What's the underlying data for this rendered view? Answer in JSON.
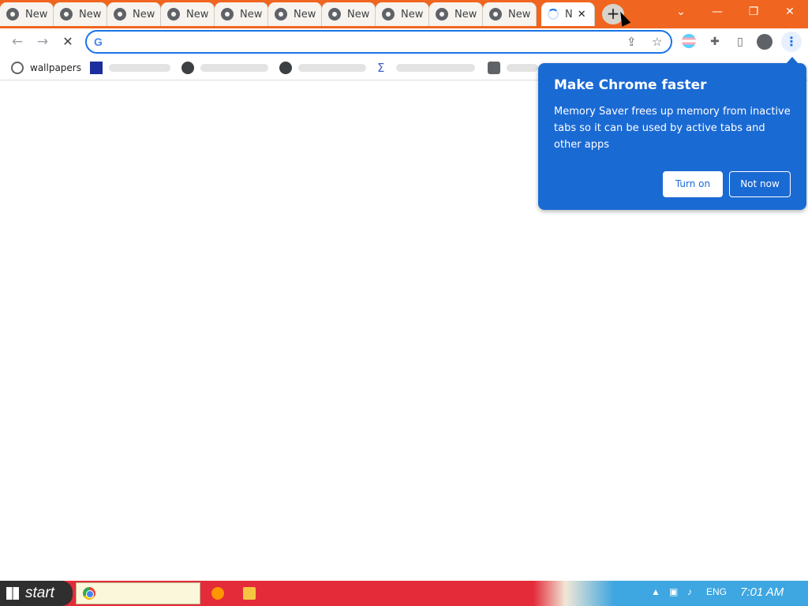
{
  "browser": {
    "tabs": [
      {
        "label": "New",
        "state": "loaded"
      },
      {
        "label": "New",
        "state": "loaded"
      },
      {
        "label": "New",
        "state": "loaded"
      },
      {
        "label": "New",
        "state": "loaded"
      },
      {
        "label": "New",
        "state": "loaded"
      },
      {
        "label": "New",
        "state": "loaded"
      },
      {
        "label": "New",
        "state": "loaded"
      },
      {
        "label": "New",
        "state": "loaded"
      },
      {
        "label": "New",
        "state": "loaded"
      },
      {
        "label": "New",
        "state": "loaded"
      },
      {
        "label": "N",
        "state": "loading",
        "active": true
      }
    ],
    "new_tab_icon": "plus-icon",
    "window_controls": [
      "chevron-down-icon",
      "minimize-icon",
      "restore-icon",
      "close-icon"
    ],
    "toolbar": {
      "back_icon": "arrow-left-icon",
      "forward_icon": "arrow-right-icon",
      "stop_icon": "stop-loading-icon",
      "omnibox_value": "",
      "omnibox_icon": "google-g-icon",
      "share_icon": "share-icon",
      "bookmark_star_icon": "star-icon",
      "extensions_icon": "puzzle-icon",
      "side_panel_icon": "side-panel-icon",
      "profile_icon": "person-icon",
      "menu_icon": "kebab-menu-icon"
    },
    "bookmarks": [
      {
        "label": "wallpapers",
        "icon": "globe-icon"
      },
      {
        "label": "[placeholder]",
        "icon": "generic-site-icon"
      },
      {
        "label": "[placeholder]",
        "icon": "globe-icon"
      },
      {
        "label": "[placeholder]",
        "icon": "globe-icon"
      },
      {
        "label": "[placeholder]",
        "icon": "sigma-icon"
      },
      {
        "label": "[placeholder]",
        "icon": "generic-site-icon"
      }
    ]
  },
  "memory_saver_bubble": {
    "title": "Make Chrome faster",
    "body": "Memory Saver frees up memory from inactive tabs so it can be used by active tabs and other apps",
    "turn_on_label": "Turn on",
    "not_now_label": "Not now",
    "color": "#1a6ad4"
  },
  "taskbar": {
    "start_label": "start",
    "language": "ENG",
    "clock": "7:01 AM"
  },
  "colors": {
    "tabstrip": "#f0651f",
    "accent": "#1a73e8"
  }
}
